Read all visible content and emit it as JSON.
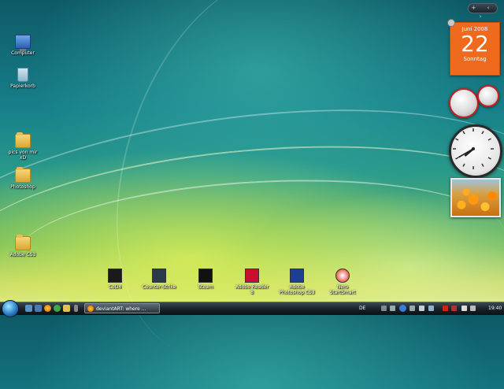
{
  "desktop": {
    "icons": [
      {
        "label": "Computer"
      },
      {
        "label": "Papierkorb"
      },
      {
        "label": "pics von mir xD"
      },
      {
        "label": "Photoshop"
      },
      {
        "label": "Adobe CS3"
      }
    ],
    "shortcuts": [
      {
        "label": "CoD4"
      },
      {
        "label": "Counter-Strike"
      },
      {
        "label": "Steam"
      },
      {
        "label": "Adobe Reader 8"
      },
      {
        "label": "Adobe Photoshop CS3"
      },
      {
        "label": "Nero StartSmart"
      }
    ]
  },
  "sidebar": {
    "controls": "+ ‹ ›",
    "calendar": {
      "month": "Juni 2008",
      "day": "22",
      "weekday": "Sonntag"
    },
    "clock": {
      "hour": 7,
      "minute": 40
    }
  },
  "taskbar": {
    "window_button": "deviantART: where ...",
    "language": "DE",
    "time": "19:40"
  },
  "colors": {
    "calendar": "#f06a1e",
    "taskbar": "#1a2329"
  }
}
